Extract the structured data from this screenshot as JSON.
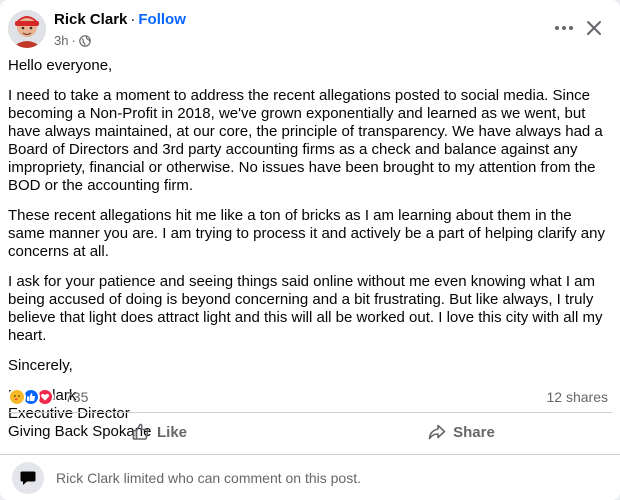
{
  "post": {
    "author": "Rick Clark",
    "separator": "·",
    "follow_label": "Follow",
    "time": "3h",
    "dot": "·",
    "paragraphs": [
      "Hello everyone,",
      "I need to take a moment to address the recent allegations posted to social media. Since becoming a Non-Profit in 2018, we've grown exponentially and learned as we went, but have always maintained, at our core, the principle of transparency. We have always had a Board of Directors and 3rd party accounting firms as a check and balance against any impropriety, financial or otherwise. No issues have been brought to my attention from the BOD or the accounting firm.",
      "These recent allegations hit me like a ton of bricks as I am learning about them in the same manner you  are. I am trying to process it and actively be a part of helping clarify any concerns at all.",
      "I ask for your patience and seeing things said online without me even knowing what I am being accused of doing is beyond concerning and a bit frustrating. But like always, I truly believe that light does attract light and this will all be worked out. I love this city with all my heart.",
      "Sincerely,"
    ],
    "signature": [
      "Rick Clark",
      "Executive Director",
      "Giving Back Spokane"
    ]
  },
  "reactions": {
    "icons": [
      "care-icon",
      "like-icon",
      "love-icon"
    ],
    "count": "735",
    "shares": "12 shares"
  },
  "actions": {
    "like_label": "Like",
    "share_label": "Share"
  },
  "comments": {
    "notice": "Rick Clark limited who can comment on this post."
  },
  "colors": {
    "follow": "#0866ff",
    "secondary_text": "#65676b",
    "like_blue": "#0866ff",
    "love_red": "#f02849",
    "care_yellow": "#f7b928"
  }
}
